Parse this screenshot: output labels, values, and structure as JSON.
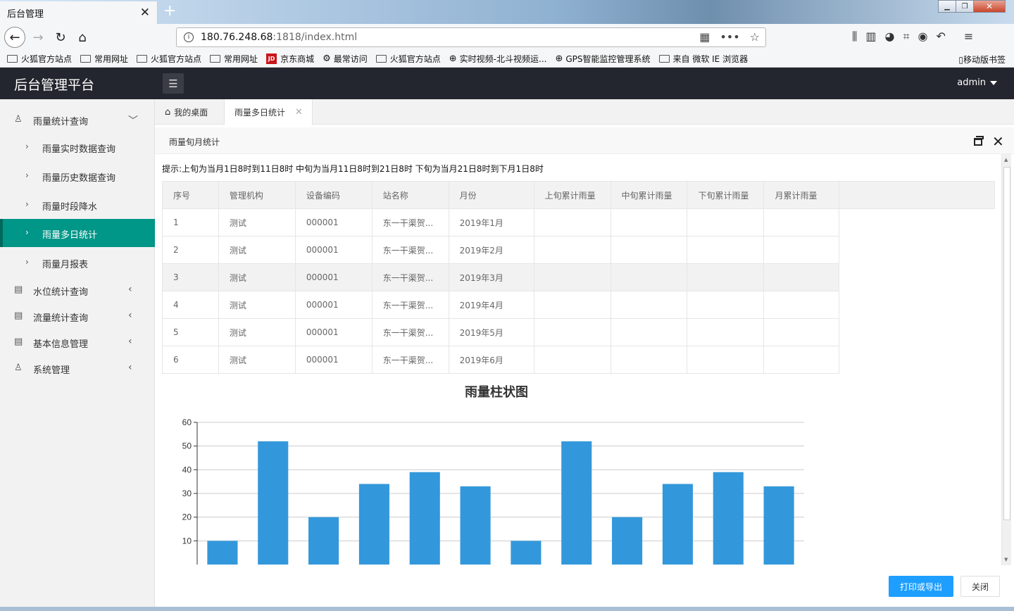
{
  "browser": {
    "tab_title": "后台管理",
    "url_host": "180.76.248.68",
    "url_path": ":1818/index.html",
    "bookmarks": [
      {
        "icon": "folder-icon",
        "label": "火狐官方站点"
      },
      {
        "icon": "folder-icon",
        "label": "常用网址"
      },
      {
        "icon": "folder-icon",
        "label": "火狐官方站点"
      },
      {
        "icon": "folder-icon",
        "label": "常用网址"
      },
      {
        "icon": "jd-icon",
        "label": "京东商城"
      },
      {
        "icon": "gear-icon",
        "label": "最常访问"
      },
      {
        "icon": "folder-icon",
        "label": "火狐官方站点"
      },
      {
        "icon": "globe-icon",
        "label": "实时视频-北斗视频运..."
      },
      {
        "icon": "globe-icon",
        "label": "GPS智能监控管理系统"
      },
      {
        "icon": "folder-icon",
        "label": "来自 微软 IE 浏览器"
      }
    ],
    "mobile_bookmarks": "移动版书签"
  },
  "header": {
    "logo": "后台管理平台",
    "user": "admin"
  },
  "sidebar": {
    "groups": [
      {
        "label": "雨量统计查询",
        "icon": "user-icon",
        "expanded": true
      },
      {
        "label": "水位统计查询",
        "icon": "document-icon",
        "expanded": false
      },
      {
        "label": "流量统计查询",
        "icon": "document-icon",
        "expanded": false
      },
      {
        "label": "基本信息管理",
        "icon": "document-icon",
        "expanded": false
      },
      {
        "label": "系统管理",
        "icon": "user-icon",
        "expanded": false
      }
    ],
    "items": [
      {
        "label": "雨量实时数据查询"
      },
      {
        "label": "雨量历史数据查询"
      },
      {
        "label": "雨量时段降水"
      },
      {
        "label": "雨量多日统计",
        "active": true
      },
      {
        "label": "雨量月报表"
      }
    ],
    "active_color": "#009688"
  },
  "tabs": {
    "home": "我的桌面",
    "current": "雨量多日统计"
  },
  "panel": {
    "title": "雨量旬月统计",
    "hint": "提示:上旬为当月1日8时到11日8时  中旬为当月11日8时到21日8时  下旬为当月21日8时到下月1日8时",
    "columns": [
      "序号",
      "管理机构",
      "设备编码",
      "站名称",
      "月份",
      "上旬累计雨量",
      "中旬累计雨量",
      "下旬累计雨量",
      "月累计雨量"
    ],
    "rows": [
      [
        "1",
        "测试",
        "000001",
        "东一干渠贺...",
        "2019年1月",
        "",
        "",
        "",
        ""
      ],
      [
        "2",
        "测试",
        "000001",
        "东一干渠贺...",
        "2019年2月",
        "",
        "",
        "",
        ""
      ],
      [
        "3",
        "测试",
        "000001",
        "东一干渠贺...",
        "2019年3月",
        "",
        "",
        "",
        ""
      ],
      [
        "4",
        "测试",
        "000001",
        "东一干渠贺...",
        "2019年4月",
        "",
        "",
        "",
        ""
      ],
      [
        "5",
        "测试",
        "000001",
        "东一干渠贺...",
        "2019年5月",
        "",
        "",
        "",
        ""
      ],
      [
        "6",
        "测试",
        "000001",
        "东一干渠贺...",
        "2019年6月",
        "",
        "",
        "",
        ""
      ]
    ],
    "export_button": "打印或导出",
    "close_button": "关闭",
    "primary_color": "#1e9fff"
  },
  "chart_data": {
    "type": "bar",
    "title": "雨量柱状图",
    "categories": [
      "",
      "",
      "",
      "",
      "",
      "",
      "",
      "",
      "",
      "",
      "",
      ""
    ],
    "values": [
      10,
      52,
      20,
      34,
      39,
      33,
      10,
      52,
      20,
      34,
      39,
      33
    ],
    "ylim": [
      0,
      60
    ],
    "yticks": [
      10,
      20,
      30,
      40,
      50,
      60
    ],
    "grid": true,
    "bar_color": "#3398db"
  }
}
